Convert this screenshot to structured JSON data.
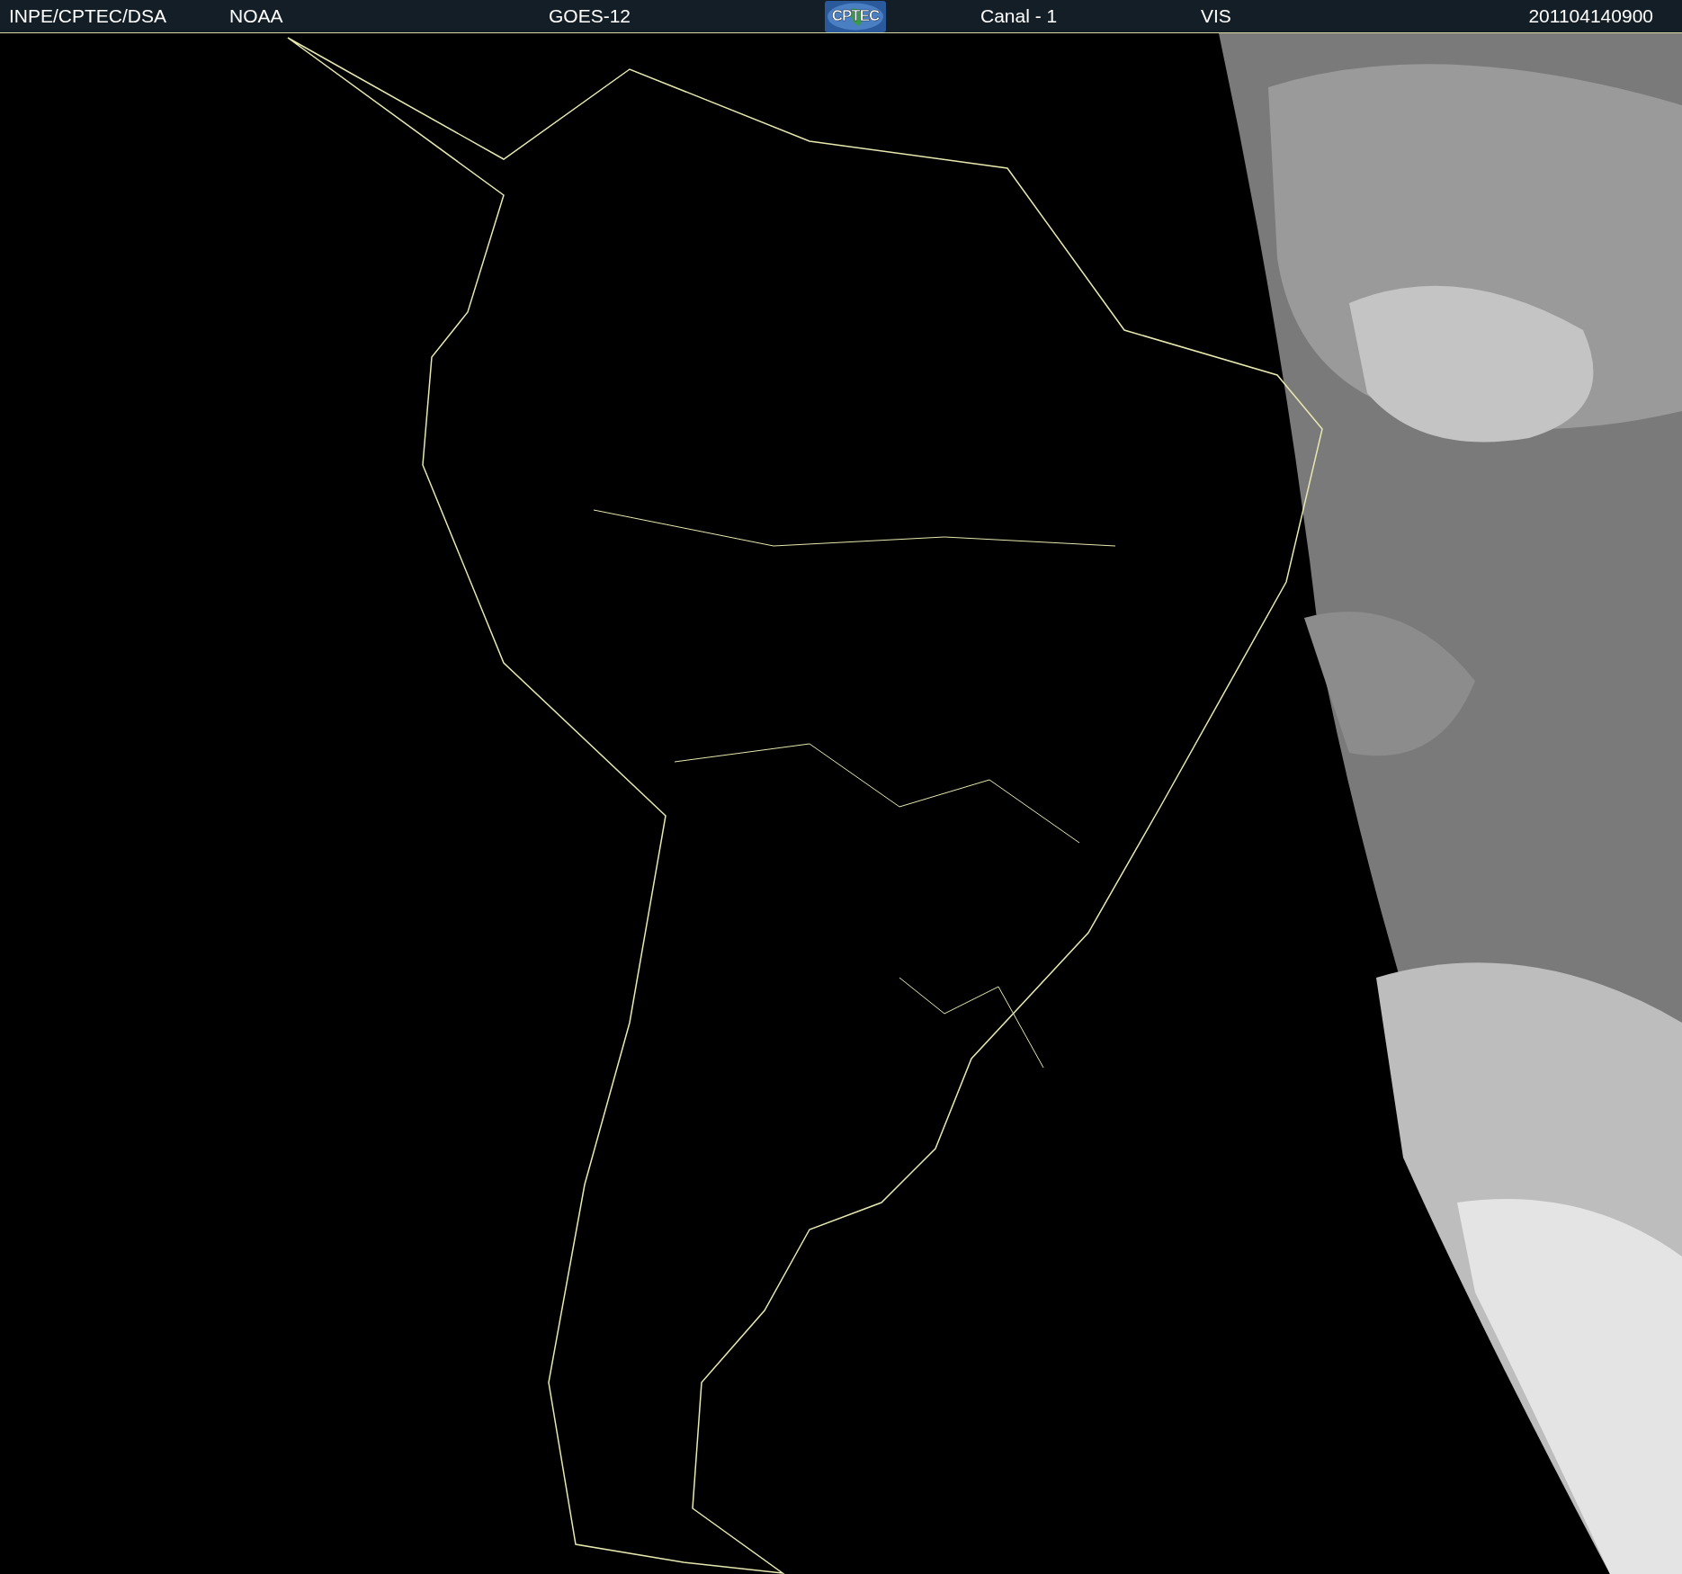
{
  "header": {
    "items": [
      {
        "kind": "text",
        "text": "INPE/CPTEC/DSA"
      },
      {
        "kind": "text",
        "text": "NOAA"
      },
      {
        "kind": "text",
        "text": "GOES-12"
      },
      {
        "kind": "logo",
        "text": "CPTEC"
      },
      {
        "kind": "text",
        "text": "Canal - 1"
      },
      {
        "kind": "text",
        "text": "VIS"
      },
      {
        "kind": "text",
        "text": "201104140900"
      }
    ]
  }
}
